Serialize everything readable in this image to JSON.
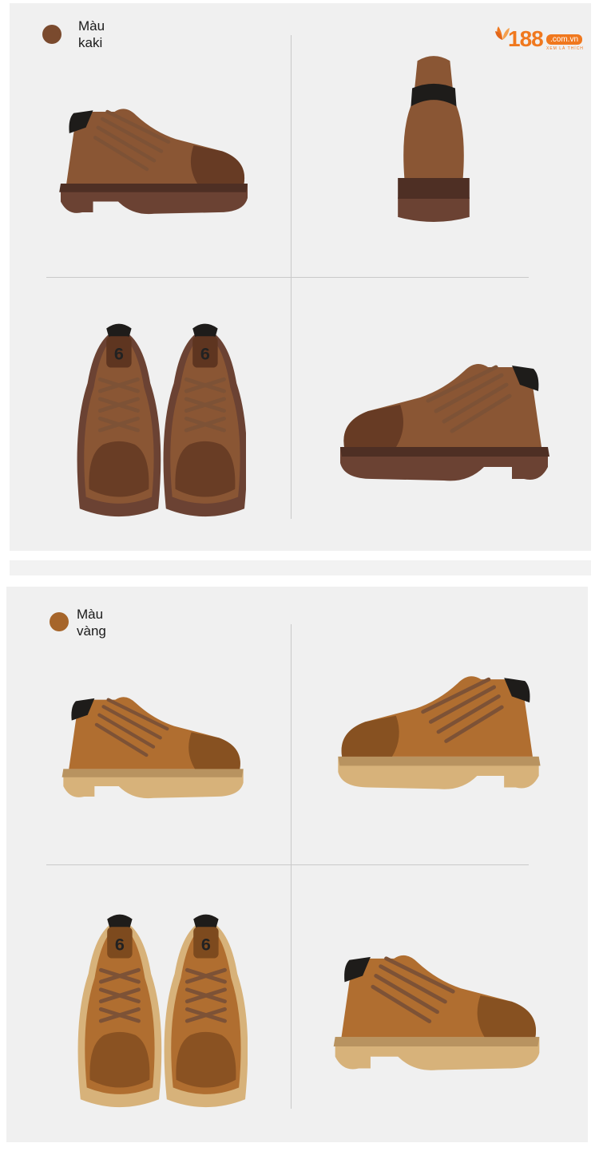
{
  "logo": {
    "brand": "188",
    "domain": ".com.vn",
    "tagline": "XEM LÀ THÍCH"
  },
  "sections": [
    {
      "label_line1": "Màu",
      "label_line2": "kaki",
      "swatch": "#7a4a2e",
      "upper": "#8a5634",
      "upper_dark": "#5e3520",
      "sole": "#6b4233",
      "sole_dark": "#4e2f24"
    },
    {
      "label_line1": "Màu",
      "label_line2": "vàng",
      "swatch": "#a6652a",
      "upper": "#b06e30",
      "upper_dark": "#7d4a1e",
      "sole": "#d7b27a",
      "sole_dark": "#b89360"
    }
  ],
  "colors": {
    "panel_bg": "#f0f0f0",
    "divider": "#c9c9c9",
    "brand_orange": "#f0781e",
    "collar": "#1e1c1a",
    "lace": "#7d5236"
  }
}
